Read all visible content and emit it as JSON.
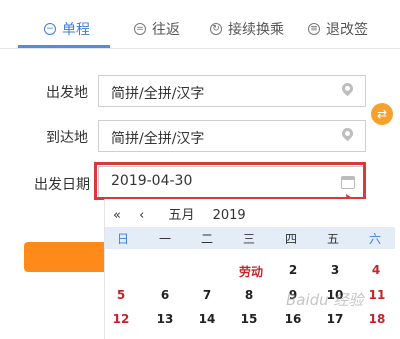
{
  "tabs": [
    {
      "label": "单程",
      "icon": "minus-circle-icon",
      "glyph": "−",
      "active": true
    },
    {
      "label": "往返",
      "icon": "equals-circle-icon",
      "glyph": "=",
      "active": false
    },
    {
      "label": "接续换乘",
      "icon": "refresh-circle-icon",
      "glyph": "↻",
      "active": false
    },
    {
      "label": "退改签",
      "icon": "ticket-circle-icon",
      "glyph": "≡",
      "active": false
    }
  ],
  "form": {
    "departure_label": "出发地",
    "departure_value": "简拼/全拼/汉字",
    "arrival_label": "到达地",
    "arrival_value": "简拼/全拼/汉字",
    "date_label": "出发日期",
    "date_value": "2019-04-30",
    "swap_glyph": "⇄"
  },
  "calendar": {
    "nav_first": "«",
    "nav_prev": "‹",
    "month": "五月",
    "year": "2019",
    "weekdays": [
      "日",
      "一",
      "二",
      "三",
      "四",
      "五",
      "六"
    ],
    "row1": [
      "",
      "",
      "",
      "劳动",
      "2",
      "3",
      "4"
    ],
    "row2": [
      "5",
      "6",
      "7",
      "8",
      "9",
      "10",
      "11"
    ],
    "row3": [
      "12",
      "13",
      "14",
      "15",
      "16",
      "17",
      "18"
    ]
  },
  "colors": {
    "accent_blue": "#3f7ed9",
    "highlight_red": "#d9393b",
    "orange": "#ff8a1a"
  },
  "watermark": "Baidu 经验"
}
